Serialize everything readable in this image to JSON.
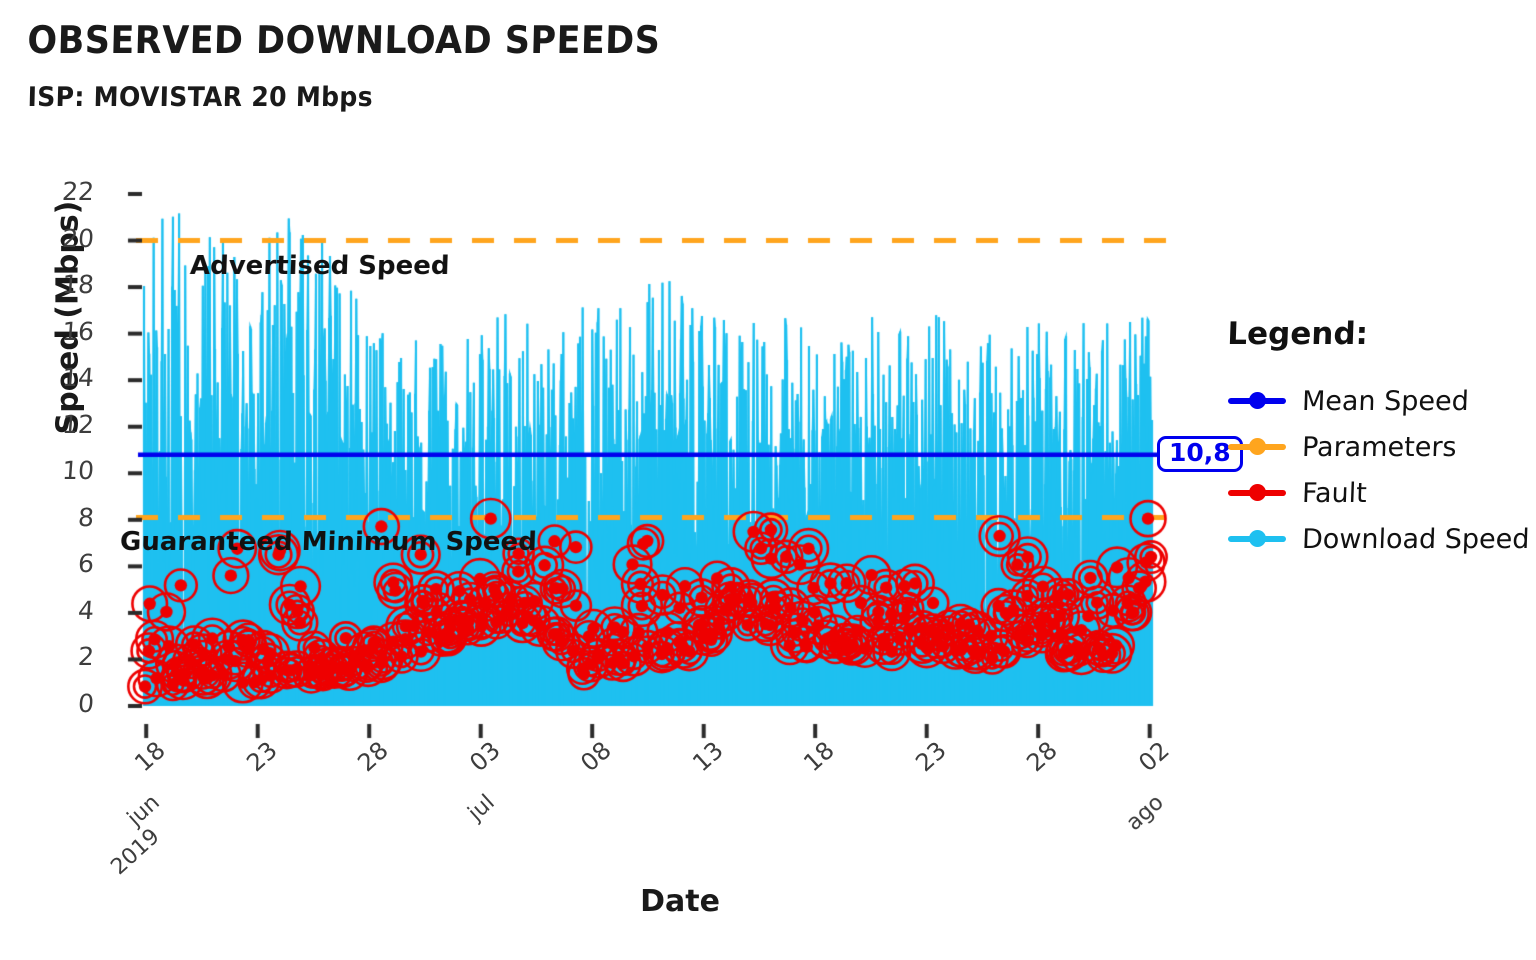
{
  "header": {
    "title": "OBSERVED DOWNLOAD SPEEDS",
    "subtitle": "ISP: MOVISTAR 20 Mbps"
  },
  "legend": {
    "title": "Legend:",
    "items": [
      {
        "label": "Mean Speed",
        "color": "#0000ee"
      },
      {
        "label": "Parameters",
        "color": "#ffa51e"
      },
      {
        "label": "Fault",
        "color": "#ee0000"
      },
      {
        "label": "Download Speed",
        "color": "#1ec0f0"
      }
    ]
  },
  "annotations": {
    "advertised": "Advertised Speed",
    "guaranteed": "Guaranteed Minimum Speed",
    "mean_value_label": "10,8"
  },
  "chart_data": {
    "type": "line",
    "title": "OBSERVED DOWNLOAD SPEEDS",
    "subtitle": "ISP: MOVISTAR 20 Mbps",
    "xlabel": "Date",
    "ylabel": "Speed (Mbps)",
    "ylim": [
      0,
      22.8
    ],
    "xlim": [
      "2019-06-18",
      "2019-08-02"
    ],
    "grid": false,
    "legend_position": "right",
    "yticks": [
      0,
      2,
      4,
      6,
      8,
      10,
      12,
      14,
      16,
      18,
      20,
      22
    ],
    "ytick_labels": [
      "0",
      "2",
      "4",
      "6",
      "8",
      "10",
      "12",
      "14",
      "16",
      "18",
      "20",
      "22"
    ],
    "xticks": [
      "18",
      "23",
      "28",
      "03",
      "08",
      "13",
      "18",
      "23",
      "28",
      "02"
    ],
    "xtick_secondary": [
      {
        "tick_index": 0,
        "lines": [
          "jun",
          "2019"
        ]
      },
      {
        "tick_index": 3,
        "lines": [
          "jul"
        ]
      },
      {
        "tick_index": 9,
        "lines": [
          "ago"
        ]
      }
    ],
    "reference_lines": [
      {
        "name": "Advertised Speed",
        "value": 20.0,
        "color": "#ffa51e",
        "style": "dashed",
        "series": "Parameters"
      },
      {
        "name": "Guaranteed Minimum Speed",
        "value": 8.1,
        "color": "#ffa51e",
        "style": "dashed",
        "series": "Parameters"
      },
      {
        "name": "Mean Speed",
        "value": 10.8,
        "color": "#0000ee",
        "style": "solid",
        "series": "Mean Speed"
      }
    ],
    "series": [
      {
        "name": "Download Speed",
        "color": "#1ec0f0",
        "type": "line",
        "sampling": "high-frequency, ~0.9 samples/px across 45 days",
        "y_range_observed": [
          0.6,
          21.6
        ],
        "note": "dense spiky trace; envelope drifts down after 23 jun then holds ~16 max",
        "envelope": {
          "x_fraction": [
            0.0,
            0.04,
            0.08,
            0.12,
            0.16,
            0.2,
            0.24,
            0.28,
            0.32,
            0.36,
            0.4,
            0.44,
            0.48,
            0.52,
            0.56,
            0.6,
            0.64,
            0.68,
            0.72,
            0.76,
            0.8,
            0.84,
            0.88,
            0.92,
            0.96,
            1.0
          ],
          "max": [
            21.5,
            21.6,
            20.2,
            21.3,
            21.5,
            18.4,
            16.6,
            15.4,
            16.5,
            17.0,
            16.6,
            17.2,
            17.8,
            18.8,
            17.0,
            16.6,
            17.0,
            17.0,
            16.8,
            16.4,
            17.0,
            16.2,
            16.6,
            16.8,
            16.4,
            16.9
          ],
          "min": [
            0.8,
            0.9,
            1.0,
            0.9,
            1.2,
            1.4,
            1.8,
            2.4,
            3.2,
            3.6,
            3.4,
            1.0,
            1.9,
            2.0,
            2.6,
            3.4,
            2.6,
            2.2,
            2.4,
            2.2,
            2.4,
            2.0,
            2.6,
            2.0,
            2.1,
            5.3
          ]
        }
      },
      {
        "name": "Fault",
        "color": "#ee0000",
        "type": "scatter",
        "marker": "filled-dot-with-ring",
        "count_approx": 280,
        "condition": "samples below Guaranteed Minimum Speed (8.1 Mbps)",
        "y_range_observed": [
          0.7,
          8.1
        ]
      }
    ],
    "mean_value": 10.8,
    "advertised_speed": 20,
    "guaranteed_minimum_speed": 8.1
  }
}
